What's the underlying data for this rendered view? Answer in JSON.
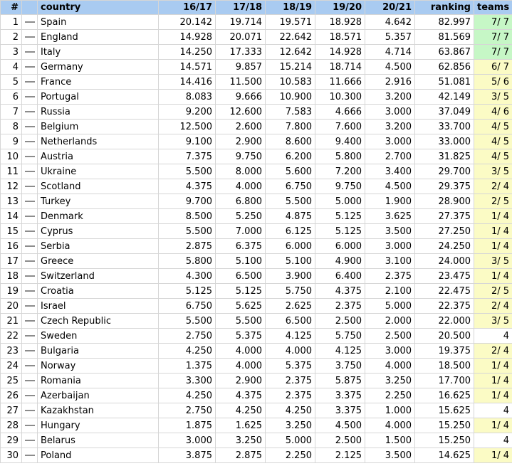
{
  "headers": {
    "num": "#",
    "flag": "",
    "country": "country",
    "y1617": "16/17",
    "y1718": "17/18",
    "y1819": "18/19",
    "y1920": "19/20",
    "y2021": "20/21",
    "ranking": "ranking",
    "teams": "teams"
  },
  "colors": {
    "header_bg": "#a9cbf1",
    "teams_all": "#c6f7c6",
    "teams_partial": "#fbfbc5"
  },
  "rows": [
    {
      "num": "1",
      "country": "Spain",
      "v1": "20.142",
      "v2": "19.714",
      "v3": "19.571",
      "v4": "18.928",
      "v5": "4.642",
      "ranking": "82.997",
      "teams": "7/ 7",
      "teams_status": "green"
    },
    {
      "num": "2",
      "country": "England",
      "v1": "14.928",
      "v2": "20.071",
      "v3": "22.642",
      "v4": "18.571",
      "v5": "5.357",
      "ranking": "81.569",
      "teams": "7/ 7",
      "teams_status": "green"
    },
    {
      "num": "3",
      "country": "Italy",
      "v1": "14.250",
      "v2": "17.333",
      "v3": "12.642",
      "v4": "14.928",
      "v5": "4.714",
      "ranking": "63.867",
      "teams": "7/ 7",
      "teams_status": "green"
    },
    {
      "num": "4",
      "country": "Germany",
      "v1": "14.571",
      "v2": "9.857",
      "v3": "15.214",
      "v4": "18.714",
      "v5": "4.500",
      "ranking": "62.856",
      "teams": "6/ 7",
      "teams_status": "yellow"
    },
    {
      "num": "5",
      "country": "France",
      "v1": "14.416",
      "v2": "11.500",
      "v3": "10.583",
      "v4": "11.666",
      "v5": "2.916",
      "ranking": "51.081",
      "teams": "5/ 6",
      "teams_status": "yellow"
    },
    {
      "num": "6",
      "country": "Portugal",
      "v1": "8.083",
      "v2": "9.666",
      "v3": "10.900",
      "v4": "10.300",
      "v5": "3.200",
      "ranking": "42.149",
      "teams": "3/ 5",
      "teams_status": "yellow"
    },
    {
      "num": "7",
      "country": "Russia",
      "v1": "9.200",
      "v2": "12.600",
      "v3": "7.583",
      "v4": "4.666",
      "v5": "3.000",
      "ranking": "37.049",
      "teams": "4/ 6",
      "teams_status": "yellow"
    },
    {
      "num": "8",
      "country": "Belgium",
      "v1": "12.500",
      "v2": "2.600",
      "v3": "7.800",
      "v4": "7.600",
      "v5": "3.200",
      "ranking": "33.700",
      "teams": "4/ 5",
      "teams_status": "yellow"
    },
    {
      "num": "9",
      "country": "Netherlands",
      "v1": "9.100",
      "v2": "2.900",
      "v3": "8.600",
      "v4": "9.400",
      "v5": "3.000",
      "ranking": "33.000",
      "teams": "4/ 5",
      "teams_status": "yellow"
    },
    {
      "num": "10",
      "country": "Austria",
      "v1": "7.375",
      "v2": "9.750",
      "v3": "6.200",
      "v4": "5.800",
      "v5": "2.700",
      "ranking": "31.825",
      "teams": "4/ 5",
      "teams_status": "yellow"
    },
    {
      "num": "11",
      "country": "Ukraine",
      "v1": "5.500",
      "v2": "8.000",
      "v3": "5.600",
      "v4": "7.200",
      "v5": "3.400",
      "ranking": "29.700",
      "teams": "3/ 5",
      "teams_status": "yellow"
    },
    {
      "num": "12",
      "country": "Scotland",
      "v1": "4.375",
      "v2": "4.000",
      "v3": "6.750",
      "v4": "9.750",
      "v5": "4.500",
      "ranking": "29.375",
      "teams": "2/ 4",
      "teams_status": "yellow"
    },
    {
      "num": "13",
      "country": "Turkey",
      "v1": "9.700",
      "v2": "6.800",
      "v3": "5.500",
      "v4": "5.000",
      "v5": "1.900",
      "ranking": "28.900",
      "teams": "2/ 5",
      "teams_status": "yellow"
    },
    {
      "num": "14",
      "country": "Denmark",
      "v1": "8.500",
      "v2": "5.250",
      "v3": "4.875",
      "v4": "5.125",
      "v5": "3.625",
      "ranking": "27.375",
      "teams": "1/ 4",
      "teams_status": "yellow"
    },
    {
      "num": "15",
      "country": "Cyprus",
      "v1": "5.500",
      "v2": "7.000",
      "v3": "6.125",
      "v4": "5.125",
      "v5": "3.500",
      "ranking": "27.250",
      "teams": "1/ 4",
      "teams_status": "yellow"
    },
    {
      "num": "16",
      "country": "Serbia",
      "v1": "2.875",
      "v2": "6.375",
      "v3": "6.000",
      "v4": "6.000",
      "v5": "3.000",
      "ranking": "24.250",
      "teams": "1/ 4",
      "teams_status": "yellow"
    },
    {
      "num": "17",
      "country": "Greece",
      "v1": "5.800",
      "v2": "5.100",
      "v3": "5.100",
      "v4": "4.900",
      "v5": "3.100",
      "ranking": "24.000",
      "teams": "3/ 5",
      "teams_status": "yellow"
    },
    {
      "num": "18",
      "country": "Switzerland",
      "v1": "4.300",
      "v2": "6.500",
      "v3": "3.900",
      "v4": "6.400",
      "v5": "2.375",
      "ranking": "23.475",
      "teams": "1/ 4",
      "teams_status": "yellow"
    },
    {
      "num": "19",
      "country": "Croatia",
      "v1": "5.125",
      "v2": "5.125",
      "v3": "5.750",
      "v4": "4.375",
      "v5": "2.100",
      "ranking": "22.475",
      "teams": "2/ 5",
      "teams_status": "yellow"
    },
    {
      "num": "20",
      "country": "Israel",
      "v1": "6.750",
      "v2": "5.625",
      "v3": "2.625",
      "v4": "2.375",
      "v5": "5.000",
      "ranking": "22.375",
      "teams": "2/ 4",
      "teams_status": "yellow"
    },
    {
      "num": "21",
      "country": "Czech Republic",
      "v1": "5.500",
      "v2": "5.500",
      "v3": "6.500",
      "v4": "2.500",
      "v5": "2.000",
      "ranking": "22.000",
      "teams": "3/ 5",
      "teams_status": "yellow"
    },
    {
      "num": "22",
      "country": "Sweden",
      "v1": "2.750",
      "v2": "5.375",
      "v3": "4.125",
      "v4": "5.750",
      "v5": "2.500",
      "ranking": "20.500",
      "teams": "4",
      "teams_status": "none"
    },
    {
      "num": "23",
      "country": "Bulgaria",
      "v1": "4.250",
      "v2": "4.000",
      "v3": "4.000",
      "v4": "4.125",
      "v5": "3.000",
      "ranking": "19.375",
      "teams": "2/ 4",
      "teams_status": "yellow"
    },
    {
      "num": "24",
      "country": "Norway",
      "v1": "1.375",
      "v2": "4.000",
      "v3": "5.375",
      "v4": "3.750",
      "v5": "4.000",
      "ranking": "18.500",
      "teams": "1/ 4",
      "teams_status": "yellow"
    },
    {
      "num": "25",
      "country": "Romania",
      "v1": "3.300",
      "v2": "2.900",
      "v3": "2.375",
      "v4": "5.875",
      "v5": "3.250",
      "ranking": "17.700",
      "teams": "1/ 4",
      "teams_status": "yellow"
    },
    {
      "num": "26",
      "country": "Azerbaijan",
      "v1": "4.250",
      "v2": "4.375",
      "v3": "2.375",
      "v4": "3.375",
      "v5": "2.250",
      "ranking": "16.625",
      "teams": "1/ 4",
      "teams_status": "yellow"
    },
    {
      "num": "27",
      "country": "Kazakhstan",
      "v1": "2.750",
      "v2": "4.250",
      "v3": "4.250",
      "v4": "3.375",
      "v5": "1.000",
      "ranking": "15.625",
      "teams": "4",
      "teams_status": "none"
    },
    {
      "num": "28",
      "country": "Hungary",
      "v1": "1.875",
      "v2": "1.625",
      "v3": "3.250",
      "v4": "4.500",
      "v5": "4.000",
      "ranking": "15.250",
      "teams": "1/ 4",
      "teams_status": "yellow"
    },
    {
      "num": "29",
      "country": "Belarus",
      "v1": "3.000",
      "v2": "3.250",
      "v3": "5.000",
      "v4": "2.500",
      "v5": "1.500",
      "ranking": "15.250",
      "teams": "4",
      "teams_status": "none"
    },
    {
      "num": "30",
      "country": "Poland",
      "v1": "3.875",
      "v2": "2.875",
      "v3": "2.250",
      "v4": "2.125",
      "v5": "3.500",
      "ranking": "14.625",
      "teams": "1/ 4",
      "teams_status": "yellow"
    }
  ]
}
